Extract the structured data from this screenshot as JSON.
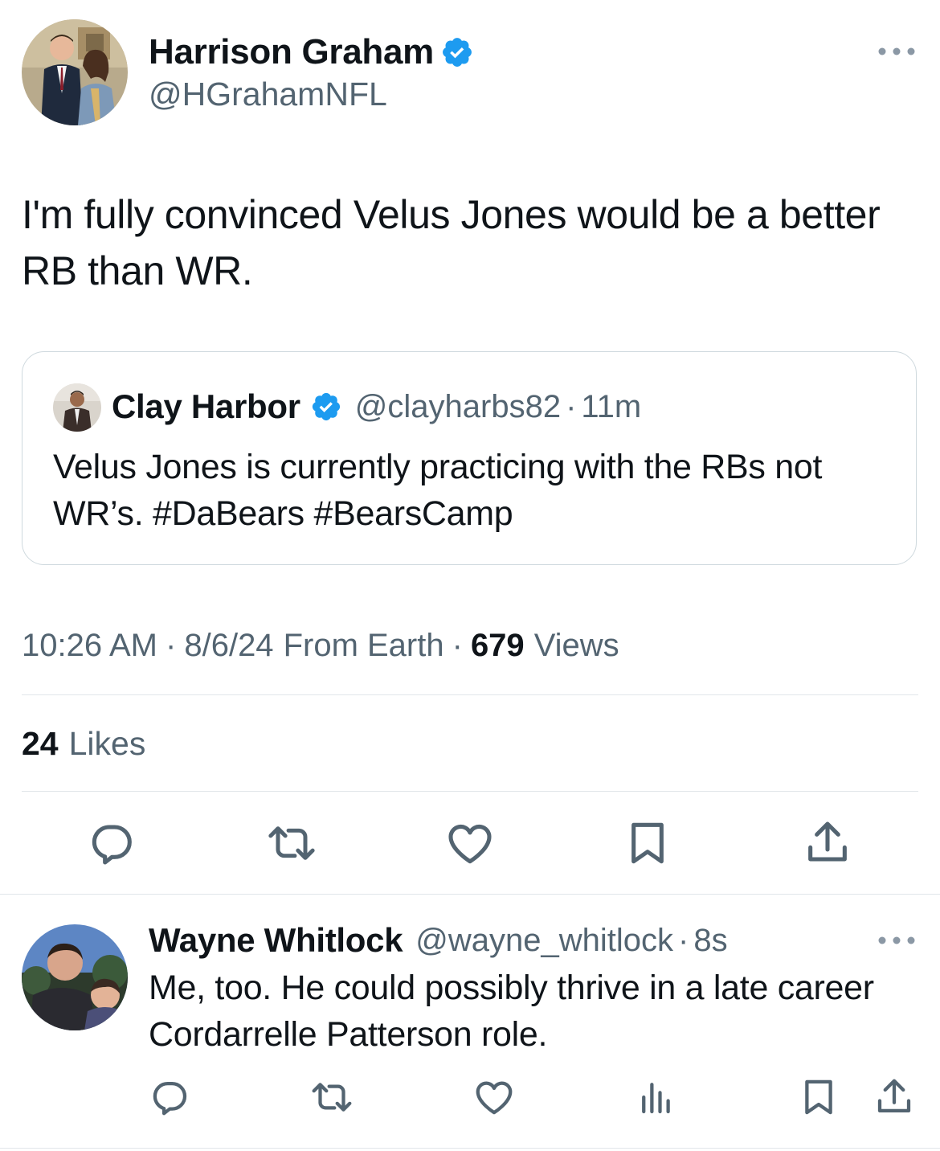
{
  "tweet": {
    "author": {
      "name": "Harrison Graham",
      "handle": "@HGrahamNFL",
      "verified": true,
      "avatar_icon": "couple-photo-avatar"
    },
    "text": "I'm fully convinced Velus Jones would be a better RB than WR.",
    "quote": {
      "author_name": "Clay Harbor",
      "handle": "@clayharbs82",
      "separator": "·",
      "age": "11m",
      "text": "Velus Jones is currently practicing with the RBs not WR’s. #DaBears #BearsCamp",
      "avatar_icon": "person-photo-avatar"
    },
    "meta": {
      "time": "10:26 AM",
      "sep1": "·",
      "date": "8/6/24",
      "source": "From Earth",
      "sep2": "·",
      "views_count": "679",
      "views_label": "Views"
    },
    "likes": {
      "count": "24",
      "label": "Likes"
    },
    "actions": [
      "reply-icon",
      "retweet-icon",
      "like-icon",
      "bookmark-icon",
      "share-icon"
    ]
  },
  "reply": {
    "author": {
      "name": "Wayne Whitlock",
      "handle": "@wayne_whitlock",
      "separator": "·",
      "age": "8s",
      "avatar_icon": "selfie-photo-avatar"
    },
    "text": "Me, too. He could possibly thrive in a late career Cordarrelle Patterson role.",
    "actions": [
      "reply-icon",
      "retweet-icon",
      "like-icon",
      "views-icon",
      "bookmark-icon",
      "share-icon"
    ]
  },
  "colors": {
    "text": "#0f1419",
    "secondary": "#536471",
    "verified": "#1d9bf0",
    "divider": "#e1e6ea"
  }
}
